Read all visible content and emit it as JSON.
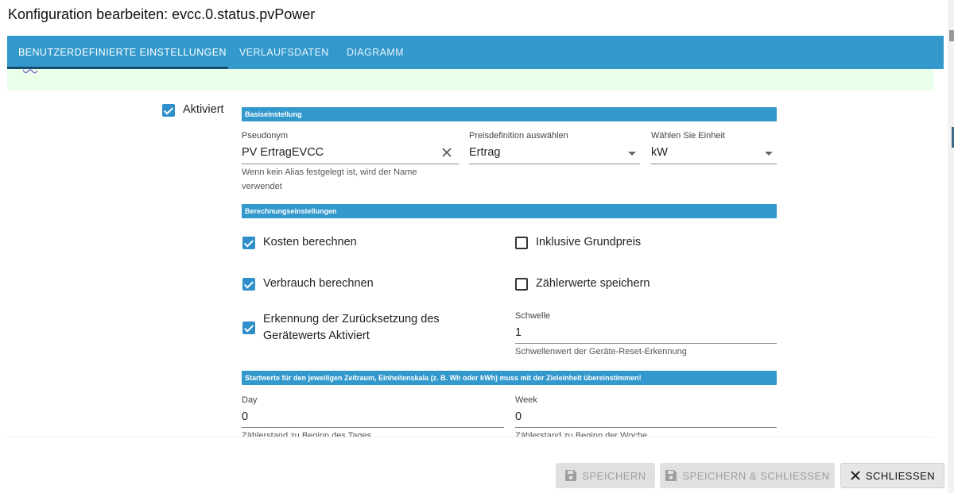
{
  "window": {
    "title": "Konfiguration bearbeiten: evcc.0.status.pvPower"
  },
  "tabs": [
    {
      "label": "BENUTZERDEFINIERTE EINSTELLUNGEN",
      "active": true
    },
    {
      "label": "VERLAUFSDATEN",
      "active": false
    },
    {
      "label": "DIAGRAMM",
      "active": false
    }
  ],
  "form": {
    "activated": {
      "label": "Aktiviert",
      "checked": true
    },
    "sections": {
      "basic": "Basiseinstellung",
      "calc": "Berechnungseinstellungen",
      "start": "Startwerte für den jeweiligen Zeitraum, Einheitenskala (z. B. Wh oder kWh) muss mit der Zieleinheit übereinstimmen!"
    },
    "alias": {
      "label": "Pseudonym",
      "value": "PV ErtragEVCC",
      "help_line1": "Wenn kein Alias festgelegt ist, wird der Name",
      "help_line2": "verwendet"
    },
    "price": {
      "label": "Preisdefinition auswählen",
      "value": "Ertrag"
    },
    "unit": {
      "label": "Wählen Sie Einheit",
      "value": "kW"
    },
    "calc_costs": {
      "label": "Kosten berechnen",
      "checked": true
    },
    "base_price": {
      "label": "Inklusive Grundpreis",
      "checked": false
    },
    "calc_consumption": {
      "label": "Verbrauch berechnen",
      "checked": true
    },
    "store_meter": {
      "label": "Zählerwerte speichern",
      "checked": false
    },
    "reset_detection": {
      "label_line1": "Erkennung der Zurücksetzung des",
      "label_line2": "Gerätewerts Aktiviert",
      "checked": true
    },
    "threshold": {
      "label": "Schwelle",
      "value": "1",
      "help": "Schwellenwert der Geräte-Reset-Erkennung"
    },
    "day": {
      "label": "Day",
      "value": "0",
      "help": "Zählerstand zu Beginn des Tages"
    },
    "week": {
      "label": "Week",
      "value": "0",
      "help": "Zählerstand zu Beginn der Woche"
    }
  },
  "footer": {
    "save": "SPEICHERN",
    "save_close": "SPEICHERN & SCHLIESSEN",
    "close": "SCHLIESSEN"
  },
  "colors": {
    "accent": "#3399cc",
    "green_strip": "#e9ffe9"
  },
  "icons": [
    "chart-icon",
    "clear-icon",
    "caret-down-icon",
    "save-icon",
    "close-icon"
  ]
}
